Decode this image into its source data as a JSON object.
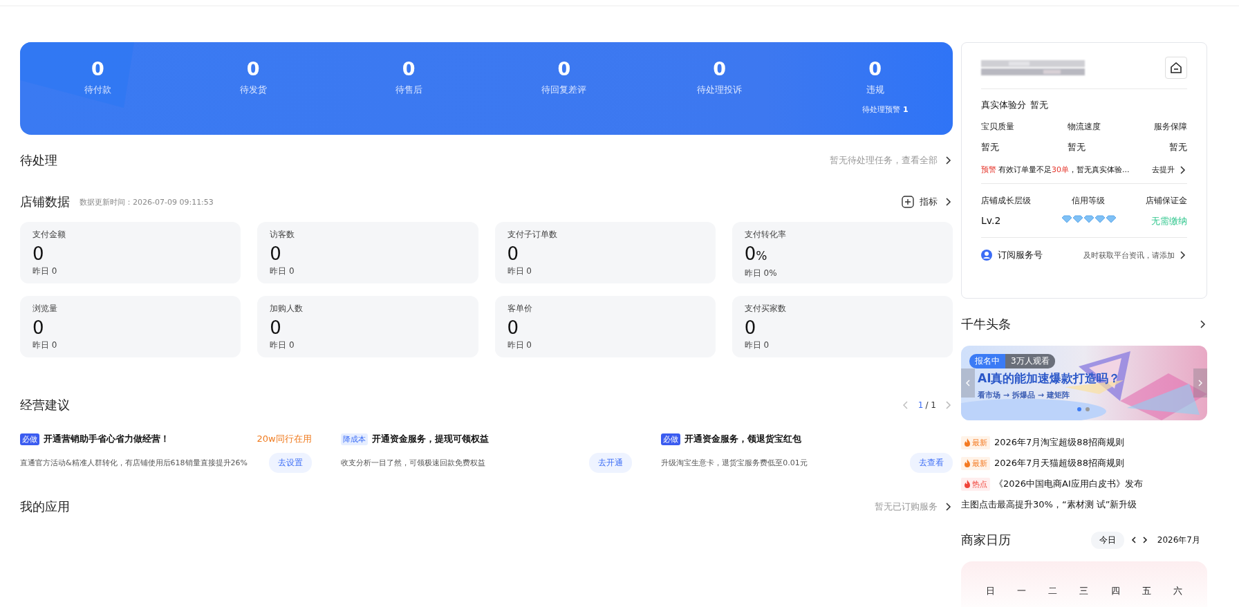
{
  "order_stats": [
    {
      "value": "0",
      "label": "待付款"
    },
    {
      "value": "0",
      "label": "待发货"
    },
    {
      "value": "0",
      "label": "待售后"
    },
    {
      "value": "0",
      "label": "待回复差评"
    },
    {
      "value": "0",
      "label": "待处理投诉"
    },
    {
      "value": "0",
      "label": "违规",
      "note": "待处理预警 **1**"
    }
  ],
  "pending": {
    "title": "待处理",
    "link": "暂无待处理任务，查看全部"
  },
  "store_data": {
    "title": "店铺数据",
    "updated": "数据更新时间：2026-07-09 09:11:53",
    "metrics_button": "指标",
    "cards": [
      {
        "label": "支付金额",
        "value": "0",
        "yesterday": "昨日 0"
      },
      {
        "label": "访客数",
        "value": "0",
        "yesterday": "昨日 0"
      },
      {
        "label": "支付子订单数",
        "value": "0",
        "yesterday": "昨日 0"
      },
      {
        "label": "支付转化率",
        "value": "0",
        "unit": "%",
        "yesterday": "昨日 0%"
      },
      {
        "label": "浏览量",
        "value": "0",
        "yesterday": "昨日 0"
      },
      {
        "label": "加购人数",
        "value": "0",
        "yesterday": "昨日 0"
      },
      {
        "label": "客单价",
        "value": "0",
        "yesterday": "昨日 0"
      },
      {
        "label": "支付买家数",
        "value": "0",
        "yesterday": "昨日 0"
      }
    ]
  },
  "advice": {
    "title": "经营建议",
    "page": "1",
    "pages": "/ 1",
    "items": [
      {
        "tag": "必做",
        "kind": "must",
        "title": "开通营销助手省心省力做经营！",
        "highlight": "20w同行在用",
        "desc": "直通官方活动&精准人群转化，有店铺使用后618销量直接提升26%",
        "button": "去设置"
      },
      {
        "tag": "降成本",
        "kind": "cost",
        "title": "开通资金服务，提现可领权益",
        "desc": "收支分析一目了然，可领极速回款免费权益",
        "button": "去开通"
      },
      {
        "tag": "必做",
        "kind": "must",
        "title": "开通资金服务，领退货宝红包",
        "desc": "升级淘宝生意卡，退货宝服务费低至0.01元",
        "button": "去查看"
      }
    ]
  },
  "my_apps": {
    "title": "我的应用",
    "link": "暂无已订购服务"
  },
  "shop_card": {
    "score_label": "真实体验分",
    "score": "暂无",
    "scores": [
      {
        "label": "宝贝质量",
        "value": "暂无"
      },
      {
        "label": "物流速度",
        "value": "暂无"
      },
      {
        "label": "服务保障",
        "value": "暂无"
      }
    ],
    "warning": "预警",
    "warning_text": "有效订单量不足**30单**，暂无真实体验...",
    "improve": "去提升",
    "levels": [
      {
        "label": "店铺成长层级",
        "value": "Lv.2",
        "kind": "text"
      },
      {
        "label": "信用等级",
        "stars": 5,
        "kind": "diamonds"
      },
      {
        "label": "店铺保证金",
        "value": "无需缴纳",
        "kind": "good"
      }
    ],
    "subscribe": "订阅服务号",
    "subscribe_hint": "及时获取平台资讯，请添加"
  },
  "news": {
    "title": "千牛头条",
    "banner": {
      "kind": "picture",
      "status": "报名中",
      "viewers": "3万人观看",
      "headline": "AI真的能加速爆款打造吗？",
      "steps": "看市场 → 拆爆品 → 建矩阵",
      "dots": [
        {
          "selected": true
        },
        {
          "selected": false
        }
      ]
    },
    "items": [
      {
        "tag": "最新",
        "kind": "new",
        "text": "2026年7月淘宝超级88招商规则"
      },
      {
        "tag": "最新",
        "kind": "new",
        "text": "2026年7月天猫超级88招商规则"
      },
      {
        "tag": "热点",
        "kind": "hot",
        "text": "《2026中国电商AI应用白皮书》发布"
      },
      {
        "text": "主图点击最高提升30%，“素材测 试”新升级"
      }
    ]
  },
  "calendar": {
    "title": "商家日历",
    "today": "今日",
    "month": "2026年7月",
    "weekdays": [
      "日",
      "一",
      "二",
      "三",
      "四",
      "五",
      "六"
    ]
  }
}
